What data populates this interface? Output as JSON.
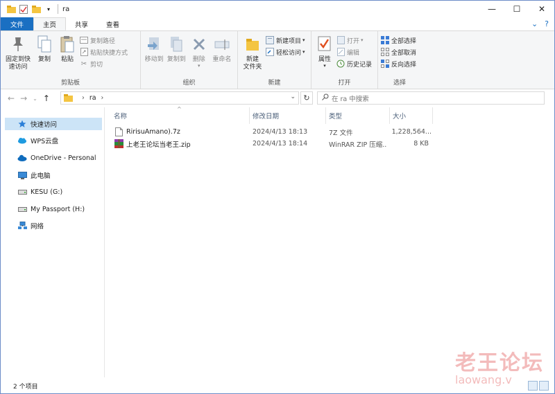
{
  "window": {
    "title": "ra"
  },
  "tabs": [
    "文件",
    "主页",
    "共享",
    "查看"
  ],
  "ribbon": {
    "clipboard": {
      "pin_label_1": "固定到快",
      "pin_label_2": "速访问",
      "copy": "复制",
      "paste": "粘贴",
      "copy_path": "复制路径",
      "paste_shortcut": "粘贴快捷方式",
      "cut": "剪切",
      "group": "剪贴板"
    },
    "organize": {
      "move_to": "移动到",
      "copy_to": "复制到",
      "delete": "删除",
      "rename": "重命名",
      "group": "组织"
    },
    "new": {
      "new_folder_1": "新建",
      "new_folder_2": "文件夹",
      "new_item": "新建项目",
      "easy_access": "轻松访问",
      "group": "新建"
    },
    "open": {
      "properties": "属性",
      "open": "打开",
      "edit": "编辑",
      "history": "历史记录",
      "group": "打开"
    },
    "select": {
      "select_all": "全部选择",
      "select_none": "全部取消",
      "invert": "反向选择",
      "group": "选择"
    }
  },
  "address": {
    "crumb": "ra"
  },
  "search": {
    "placeholder": "在 ra 中搜索"
  },
  "navpane": [
    {
      "label": "快速访问",
      "icon": "star-icon"
    },
    {
      "label": "WPS云盘",
      "icon": "cloud-icon"
    },
    {
      "label": "OneDrive - Personal",
      "icon": "onedrive-icon"
    },
    {
      "label": "此电脑",
      "icon": "computer-icon"
    },
    {
      "label": "KESU (G:)",
      "icon": "drive-icon"
    },
    {
      "label": "My Passport (H:)",
      "icon": "drive-icon"
    },
    {
      "label": "网络",
      "icon": "network-icon"
    }
  ],
  "columns": {
    "name": "名称",
    "modified": "修改日期",
    "type": "类型",
    "size": "大小"
  },
  "files": [
    {
      "name": "RirisuAmano).7z",
      "modified": "2024/4/13 18:13",
      "type": "7Z 文件",
      "size": "1,228,564..."
    },
    {
      "name": "上老王论坛当老王.zip",
      "modified": "2024/4/13 18:14",
      "type": "WinRAR ZIP 压缩...",
      "size": "8 KB"
    }
  ],
  "status": {
    "count": "2 个项目"
  },
  "watermark": {
    "cn": "老王论坛",
    "en": "laowang.v"
  },
  "colors": {
    "accent": "#1a6fc2",
    "selection": "#cce4f7"
  }
}
